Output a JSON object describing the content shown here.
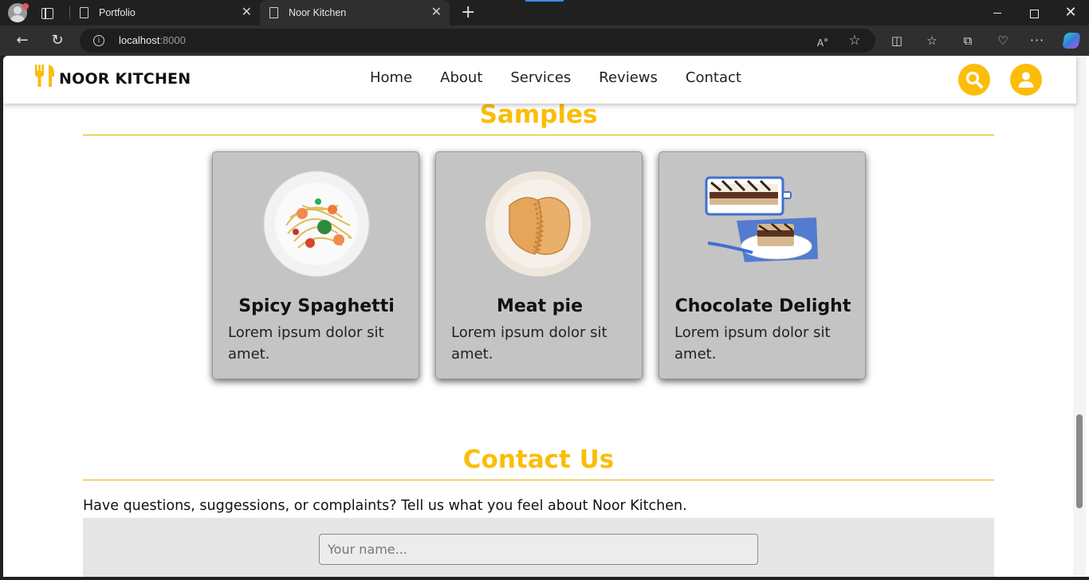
{
  "browser": {
    "tabs": [
      {
        "title": "Portfolio",
        "active": false
      },
      {
        "title": "Noor Kitchen",
        "active": true
      }
    ],
    "url_host": "localhost",
    "url_port": ":8000"
  },
  "site": {
    "brand": "NOOR KITCHEN",
    "nav": [
      "Home",
      "About",
      "Services",
      "Reviews",
      "Contact"
    ],
    "accent_color": "#fbbd08"
  },
  "samples": {
    "title": "Samples",
    "items": [
      {
        "name": "Spicy Spaghetti",
        "desc": "Lorem ipsum dolor sit amet."
      },
      {
        "name": "Meat pie",
        "desc": "Lorem ipsum dolor sit amet."
      },
      {
        "name": "Chocolate Delight",
        "desc": "Lorem ipsum dolor sit amet."
      }
    ]
  },
  "contact": {
    "title": "Contact Us",
    "text": "Have questions, suggessions, or complaints? Tell us what you feel about Noor Kitchen.",
    "name_placeholder": "Your name..."
  }
}
